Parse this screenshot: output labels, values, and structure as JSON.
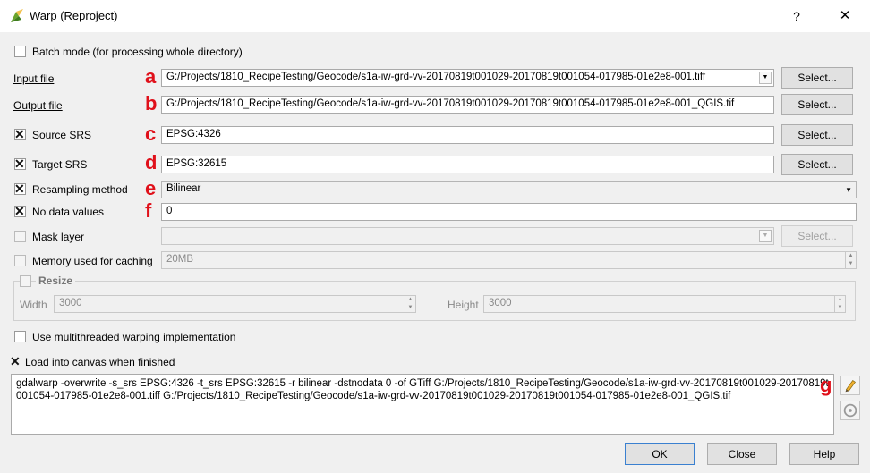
{
  "window": {
    "title": "Warp (Reproject)",
    "help_glyph": "?",
    "close_glyph": "✕"
  },
  "batch": {
    "label": "Batch mode (for processing whole directory)",
    "checked": false
  },
  "input_file": {
    "label": "Input file",
    "value": "G:/Projects/1810_RecipeTesting/Geocode/s1a-iw-grd-vv-20170819t001029-20170819t001054-017985-01e2e8-001.tiff",
    "button": "Select...",
    "marker": "a"
  },
  "output_file": {
    "label": "Output file",
    "value": "G:/Projects/1810_RecipeTesting/Geocode/s1a-iw-grd-vv-20170819t001029-20170819t001054-017985-01e2e8-001_QGIS.tif",
    "button": "Select...",
    "marker": "b"
  },
  "source_srs": {
    "label": "Source SRS",
    "value": "EPSG:4326",
    "button": "Select...",
    "marker": "c",
    "checked": true
  },
  "target_srs": {
    "label": "Target SRS",
    "value": "EPSG:32615",
    "button": "Select...",
    "marker": "d",
    "checked": true
  },
  "resampling": {
    "label": "Resampling method",
    "value": "Bilinear",
    "marker": "e",
    "checked": true
  },
  "nodata": {
    "label": "No data values",
    "value": "0",
    "marker": "f",
    "checked": true
  },
  "mask": {
    "label": "Mask layer",
    "value": "",
    "button": "Select...",
    "checked": false
  },
  "memory": {
    "label": "Memory used for caching",
    "value": "20MB",
    "checked": false
  },
  "resize": {
    "label": "Resize",
    "width_label": "Width",
    "width_value": "3000",
    "height_label": "Height",
    "height_value": "3000",
    "checked": false
  },
  "multithread": {
    "label": "Use multithreaded warping implementation",
    "checked": false
  },
  "load_canvas": {
    "label": "Load into canvas when finished",
    "checked": true
  },
  "command": {
    "text": "gdalwarp -overwrite -s_srs EPSG:4326 -t_srs EPSG:32615 -r bilinear -dstnodata 0 -of GTiff G:/Projects/1810_RecipeTesting/Geocode/s1a-iw-grd-vv-20170819t001029-20170819t001054-017985-01e2e8-001.tiff G:/Projects/1810_RecipeTesting/Geocode/s1a-iw-grd-vv-20170819t001029-20170819t001054-017985-01e2e8-001_QGIS.tif",
    "marker": "g"
  },
  "buttons": {
    "ok": "OK",
    "close": "Close",
    "help": "Help"
  },
  "colors": {
    "marker": "#e0101a",
    "background": "#f0f0f0"
  }
}
